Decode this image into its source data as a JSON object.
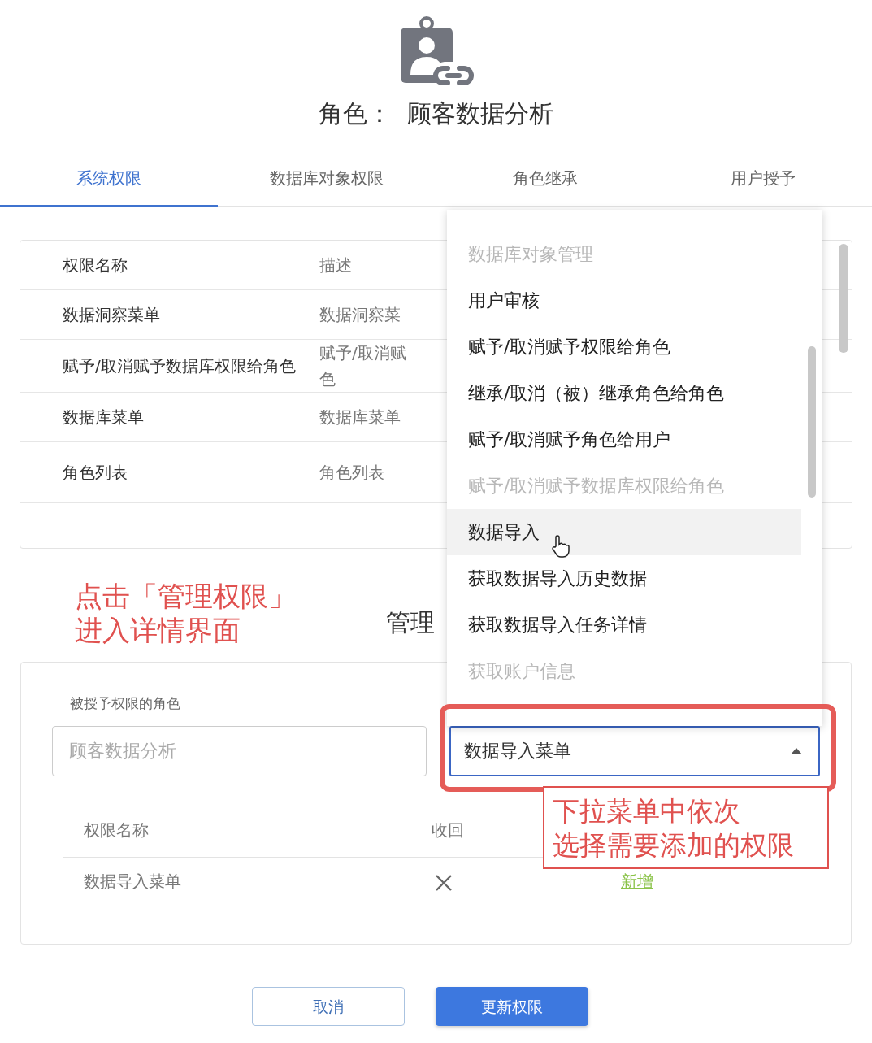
{
  "title": "角色：  顾客数据分析",
  "tabs": [
    {
      "label": "系统权限",
      "selected": true
    },
    {
      "label": "数据库对象权限",
      "selected": false
    },
    {
      "label": "角色继承",
      "selected": false
    },
    {
      "label": "用户授予",
      "selected": false
    }
  ],
  "permissions_table": {
    "columns": [
      "权限名称",
      "描述"
    ],
    "rows": [
      {
        "name": "数据洞察菜单",
        "description": [
          "数据洞察菜"
        ]
      },
      {
        "name": "赋予/取消赋予数据库权限给角色",
        "description": [
          "赋予/取消赋",
          "色"
        ]
      },
      {
        "name": "数据库菜单",
        "description": [
          "数据库菜单"
        ]
      },
      {
        "name": "角色列表",
        "description": [
          "角色列表"
        ]
      }
    ]
  },
  "manage_heading": "管理",
  "form": {
    "role_label": "被授予权限的角色",
    "role_field": {
      "value": "顾客数据分析",
      "disabled": true
    },
    "permission_select": {
      "value": "数据导入菜单",
      "expanded": true
    },
    "columns": [
      "权限名称",
      "收回"
    ],
    "rows": [
      {
        "name": "数据导入菜单",
        "action": "新增"
      }
    ]
  },
  "dropdown": {
    "items": [
      {
        "label": "数据库对象管理",
        "disabled": true,
        "hovered": false
      },
      {
        "label": "用户审核",
        "disabled": false,
        "hovered": false
      },
      {
        "label": "赋予/取消赋予权限给角色",
        "disabled": false,
        "hovered": false
      },
      {
        "label": "继承/取消（被）继承角色给角色",
        "disabled": false,
        "hovered": false
      },
      {
        "label": "赋予/取消赋予角色给用户",
        "disabled": false,
        "hovered": false
      },
      {
        "label": "赋予/取消赋予数据库权限给角色",
        "disabled": true,
        "hovered": false
      },
      {
        "label": "数据导入",
        "disabled": false,
        "hovered": true
      },
      {
        "label": "获取数据导入历史数据",
        "disabled": false,
        "hovered": false
      },
      {
        "label": "获取数据导入任务详情",
        "disabled": false,
        "hovered": false
      },
      {
        "label": "获取账户信息",
        "disabled": true,
        "hovered": false
      }
    ]
  },
  "buttons": [
    {
      "label": "取消",
      "kind": "secondary"
    },
    {
      "label": "更新权限",
      "kind": "primary"
    }
  ],
  "annotations": [
    {
      "kind": "plain",
      "lines": [
        "点击「管理权限」",
        "进入详情界面"
      ]
    },
    {
      "kind": "boxed",
      "lines": [
        "下拉菜单中依次",
        "选择需要添加的权限"
      ]
    }
  ]
}
